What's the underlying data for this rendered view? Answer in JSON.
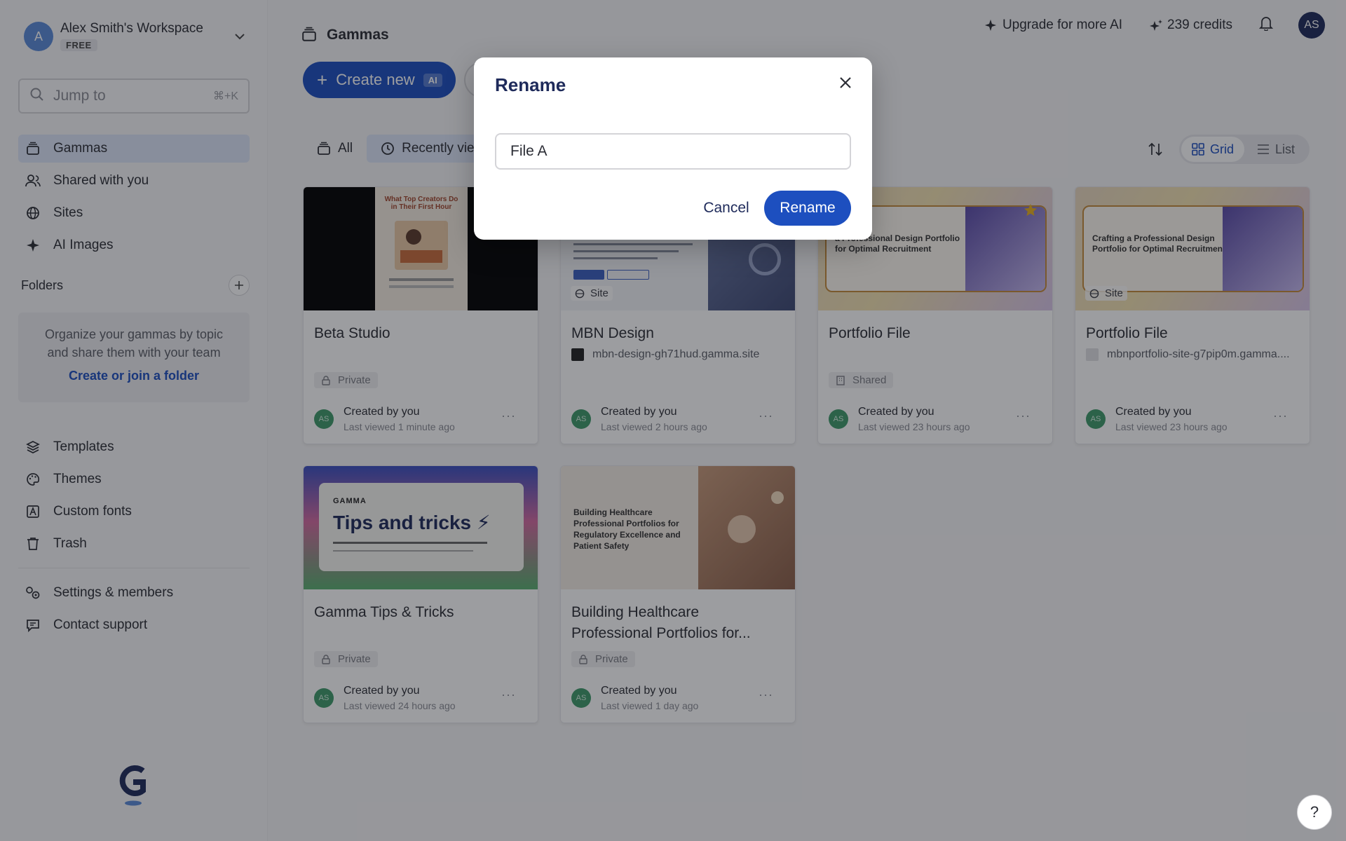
{
  "workspace": {
    "avatar": "A",
    "name": "Alex Smith's Workspace",
    "plan": "FREE"
  },
  "search": {
    "placeholder": "Jump to",
    "shortcut": "⌘+K"
  },
  "nav_primary": [
    {
      "label": "Gammas",
      "icon": "stack-icon"
    },
    {
      "label": "Shared with you",
      "icon": "users-icon"
    },
    {
      "label": "Sites",
      "icon": "globe-icon"
    },
    {
      "label": "AI Images",
      "icon": "sparkle-icon"
    }
  ],
  "folders": {
    "title": "Folders",
    "desc_line1": "Organize your gammas by topic",
    "desc_line2": "and share them with your team",
    "link": "Create or join a folder"
  },
  "nav_secondary": [
    {
      "label": "Templates",
      "icon": "layers-icon"
    },
    {
      "label": "Themes",
      "icon": "palette-icon"
    },
    {
      "label": "Custom fonts",
      "icon": "font-icon"
    },
    {
      "label": "Trash",
      "icon": "trash-icon"
    }
  ],
  "nav_tertiary": [
    {
      "label": "Settings & members",
      "icon": "settings-icon"
    },
    {
      "label": "Contact support",
      "icon": "chat-icon"
    }
  ],
  "header": {
    "title": "Gammas",
    "upgrade": "Upgrade for more AI",
    "credits": "239 credits",
    "user_initials": "AS"
  },
  "toolbar": {
    "create_label": "Create new",
    "create_badge": "AI",
    "tab_all": "All",
    "tab_recent": "Recently viewed",
    "view_grid": "Grid",
    "view_list": "List"
  },
  "cards": [
    {
      "title": "Beta Studio",
      "subtitle": "",
      "badge": "Private",
      "created": "Created by you",
      "viewed": "Last viewed 1 minute ago",
      "thumb_text": "What Top Creators Do in Their First Hour",
      "site": ""
    },
    {
      "title": "MBN Design",
      "subtitle": "mbn-design-gh71hud.gamma.site",
      "badge": "",
      "created": "Created by you",
      "viewed": "Last viewed 2 hours ago",
      "thumb_text": "",
      "site": "Site"
    },
    {
      "title": "Portfolio File",
      "subtitle": "",
      "badge": "Shared",
      "created": "Created by you",
      "viewed": "Last viewed 23 hours ago",
      "thumb_text": "a Professional Design Portfolio for Optimal Recruitment",
      "site": ""
    },
    {
      "title": "Portfolio File",
      "subtitle": "mbnportfolio-site-g7pip0m.gamma....",
      "badge": "",
      "created": "Created by you",
      "viewed": "Last viewed 23 hours ago",
      "thumb_text": "Crafting a Professional Design Portfolio for Optimal Recruitment",
      "site": "Site"
    },
    {
      "title": "Gamma Tips & Tricks",
      "subtitle": "",
      "badge": "Private",
      "created": "Created by you",
      "viewed": "Last viewed 24 hours ago",
      "thumb_text": "Tips and tricks ⚡",
      "thumb_brand": "GAMMA",
      "site": ""
    },
    {
      "title_line1": "Building Healthcare",
      "title_line2": "Professional Portfolios for...",
      "subtitle": "",
      "badge": "Private",
      "created": "Created by you",
      "viewed": "Last viewed 1 day ago",
      "thumb_text": "Building Healthcare Professional Portfolios for Regulatory Excellence and Patient Safety",
      "site": ""
    }
  ],
  "avatar_initials": "AS",
  "modal": {
    "title": "Rename",
    "input_value": "File A",
    "cancel": "Cancel",
    "confirm": "Rename"
  },
  "help": "?",
  "colors": {
    "accent": "#1d4fbf",
    "active_nav": "#dde6f8",
    "avatar_green": "#3f9a6a"
  }
}
